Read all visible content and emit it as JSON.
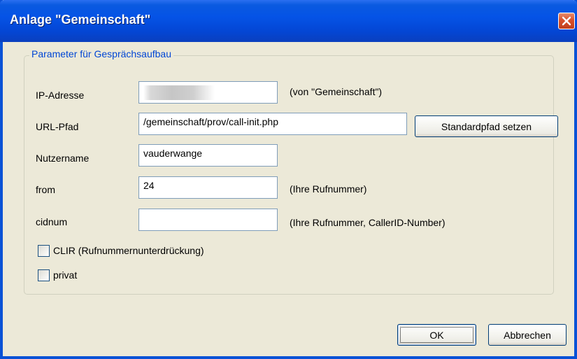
{
  "window": {
    "title": "Anlage \"Gemeinschaft\"",
    "close_symbol": "close-icon"
  },
  "group": {
    "legend": "Parameter für Gesprächsaufbau"
  },
  "fields": {
    "ip": {
      "label": "IP-Adresse",
      "value": "",
      "hint": "(von \"Gemeinschaft\")"
    },
    "url": {
      "label": "URL-Pfad",
      "value": "/gemeinschaft/prov/call-init.php"
    },
    "user": {
      "label": "Nutzername",
      "value": "vauderwange"
    },
    "from": {
      "label": "from",
      "value": "24",
      "hint": "(Ihre Rufnummer)"
    },
    "cidnum": {
      "label": "cidnum",
      "value": "",
      "hint": "(Ihre Rufnummer, CallerID-Number)"
    }
  },
  "buttons": {
    "standardpfad": "Standardpfad setzen",
    "ok": "OK",
    "cancel": "Abbrechen"
  },
  "checkboxes": {
    "clir": {
      "label": "CLIR (Rufnummernunterdrückung)",
      "checked": false
    },
    "privat": {
      "label": "privat",
      "checked": false
    }
  },
  "colors": {
    "titlebar": "#0553e6",
    "dialog_bg": "#ece9d8",
    "legend_text": "#0046d5",
    "close_button": "#d8502a"
  }
}
